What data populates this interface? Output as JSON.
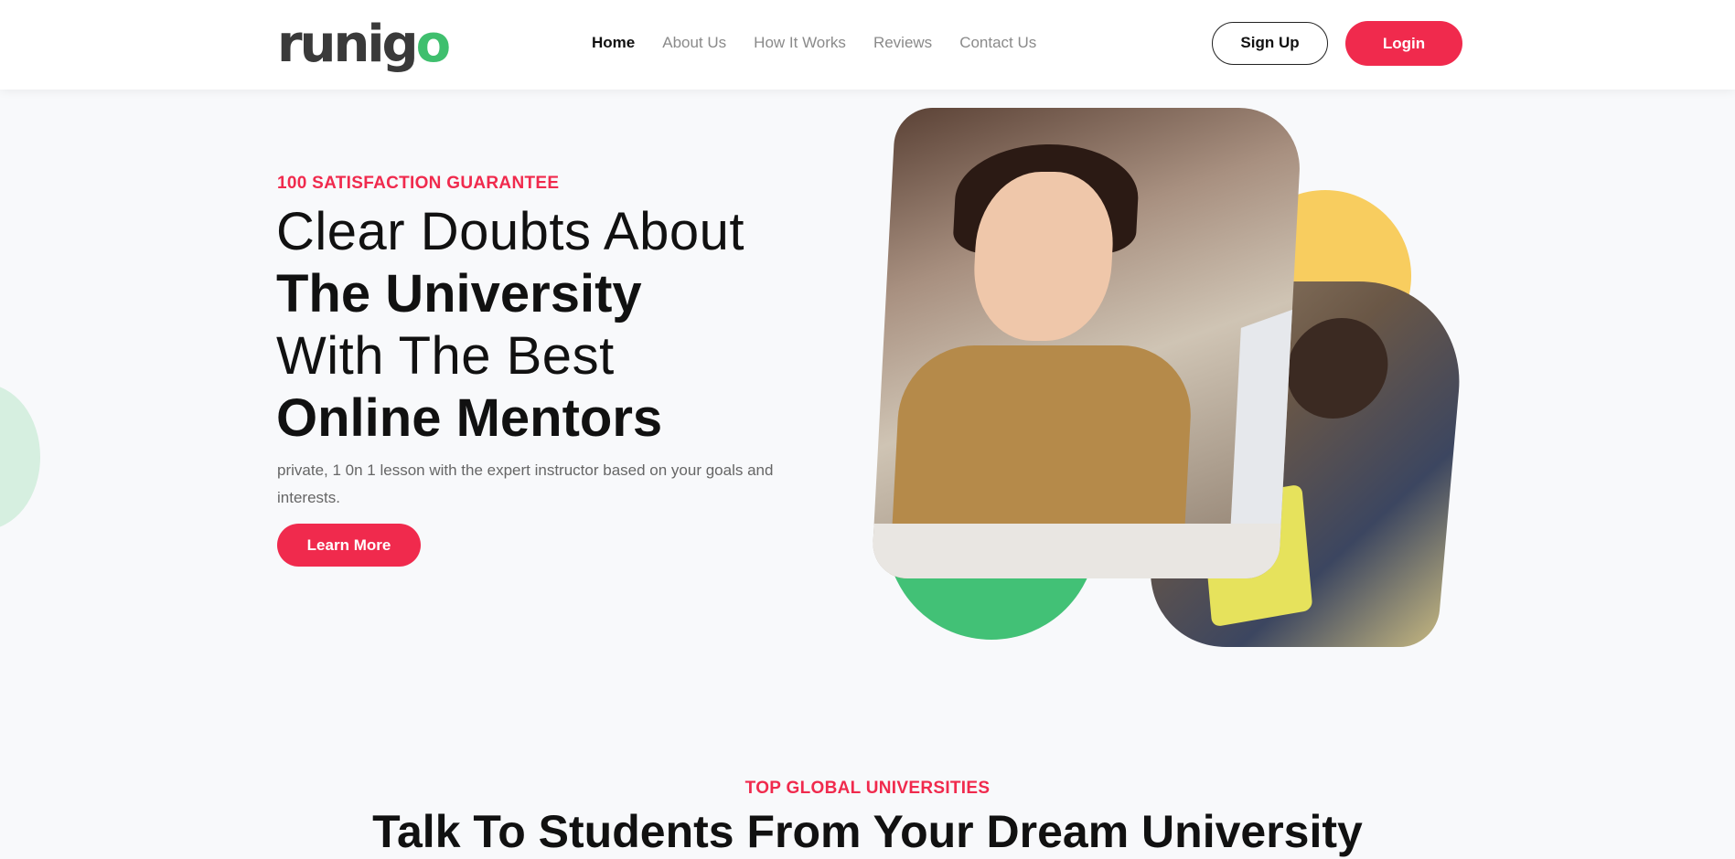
{
  "header": {
    "logo_prefix": "runig",
    "logo_suffix": "o",
    "nav": [
      {
        "label": "Home",
        "active": true
      },
      {
        "label": "About Us"
      },
      {
        "label": "How It Works"
      },
      {
        "label": "Reviews"
      },
      {
        "label": "Contact Us"
      }
    ],
    "signup_label": "Sign Up",
    "login_label": "Login"
  },
  "hero": {
    "eyebrow": "100 SATISFACTION GUARANTEE",
    "headline_line1": "Clear Doubts About",
    "headline_line2": "The University",
    "headline_line3": "With The Best",
    "headline_line4": "Online Mentors",
    "subtext": "private, 1 0n 1 lesson with the expert instructor based on your goals and interests.",
    "cta_label": "Learn More"
  },
  "universities": {
    "eyebrow": "TOP GLOBAL UNIVERSITIES",
    "title_part1": "Talk",
    "title_part2": " To Students From Your ",
    "title_part3": "Dream University"
  },
  "colors": {
    "accent": "#f02a4d",
    "green": "#42c176",
    "yellow": "#f8cd5f",
    "text": "#111111"
  }
}
